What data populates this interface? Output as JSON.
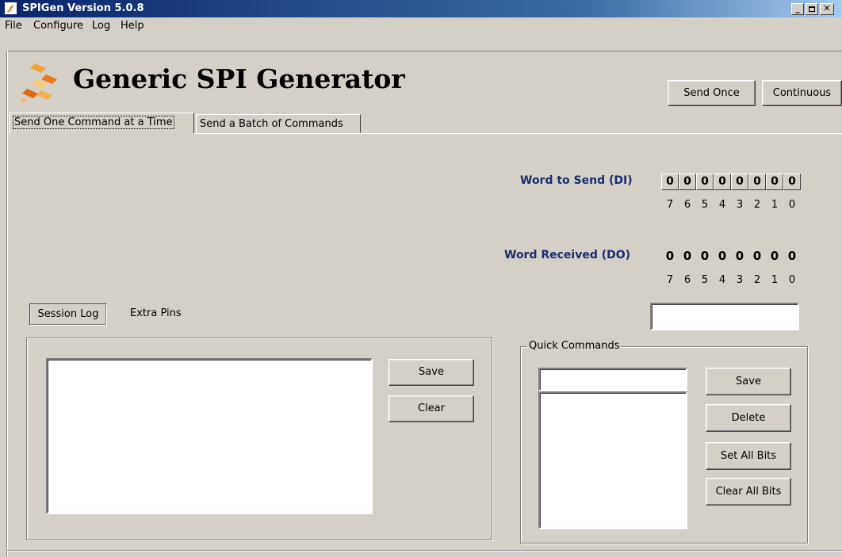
{
  "window": {
    "title": "SPIGen Version 5.0.8",
    "controls": [
      "_",
      "□",
      "X"
    ]
  },
  "menu": [
    "File",
    "Configure",
    "Log",
    "Help"
  ],
  "header": {
    "title": "Generic SPI Generator",
    "send_once": "Send Once",
    "continuous": "Continuous"
  },
  "tabs": [
    {
      "label": "Send One Command at a Time",
      "active": true
    },
    {
      "label": "Send a Batch of Commands",
      "active": false
    }
  ],
  "word_to_send": {
    "label": "Word to Send (DI)",
    "bits": [
      "0",
      "0",
      "0",
      "0",
      "0",
      "0",
      "0",
      "0"
    ],
    "bit_numbers": [
      "7",
      "6",
      "5",
      "4",
      "3",
      "2",
      "1",
      "0"
    ]
  },
  "word_received": {
    "label": "Word Received (DO)",
    "bits": [
      "0",
      "0",
      "0",
      "0",
      "0",
      "0",
      "0",
      "0"
    ],
    "bit_numbers": [
      "7",
      "6",
      "5",
      "4",
      "3",
      "2",
      "1",
      "0"
    ]
  },
  "hex_field": {
    "value": ""
  },
  "session": {
    "tab_session_log": "Session Log",
    "tab_extra_pins": "Extra Pins",
    "save": "Save",
    "clear": "Clear"
  },
  "quick_commands": {
    "label": "Quick Commands",
    "input_value": "",
    "save": "Save",
    "delete": "Delete",
    "set_all_bits": "Set All Bits",
    "clear_all_bits": "Clear All Bits"
  },
  "colors": {
    "titlebar_start": "#0a246a",
    "label_blue": "#1a2e6e",
    "face": "#d4d0c8"
  }
}
